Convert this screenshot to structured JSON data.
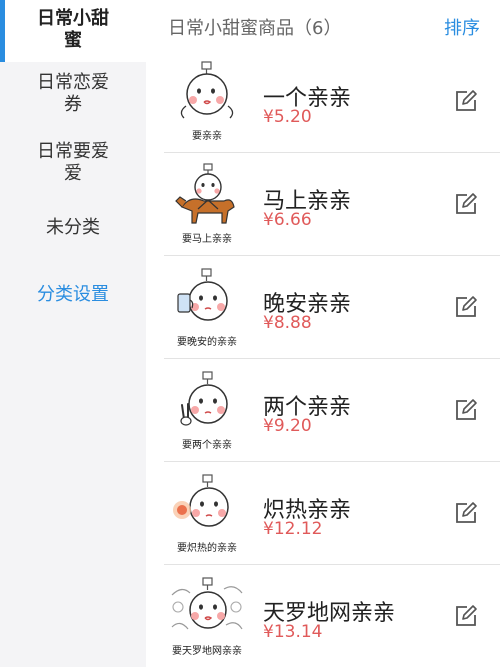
{
  "sidebar": {
    "categories": [
      {
        "label": "日常小甜蜜"
      },
      {
        "label": "日常恋爱券"
      },
      {
        "label": "日常要爱爱"
      },
      {
        "label": "未分类"
      }
    ],
    "settings_label": "分类设置"
  },
  "header": {
    "title": "日常小甜蜜商品（6）",
    "sort_label": "排序"
  },
  "items": [
    {
      "name": "一个亲亲",
      "price": "¥5.20",
      "caption": "要亲亲",
      "icon": "kiss-sticker"
    },
    {
      "name": "马上亲亲",
      "price": "¥6.66",
      "caption": "要马上亲亲",
      "icon": "horse-rider-sticker"
    },
    {
      "name": "晚安亲亲",
      "price": "¥8.88",
      "caption": "要晚安的亲亲",
      "icon": "goodnight-sticker"
    },
    {
      "name": "两个亲亲",
      "price": "¥9.20",
      "caption": "要两个亲亲",
      "icon": "two-fingers-sticker"
    },
    {
      "name": "炽热亲亲",
      "price": "¥12.12",
      "caption": "要炽热的亲亲",
      "icon": "fire-sticker"
    },
    {
      "name": "天罗地网亲亲",
      "price": "¥13.14",
      "caption": "要天罗地网亲亲",
      "icon": "net-sticker"
    }
  ],
  "colors": {
    "accent": "#2a8de0",
    "price": "#e05a5a",
    "sidebar_bg": "#f4f4f6"
  }
}
